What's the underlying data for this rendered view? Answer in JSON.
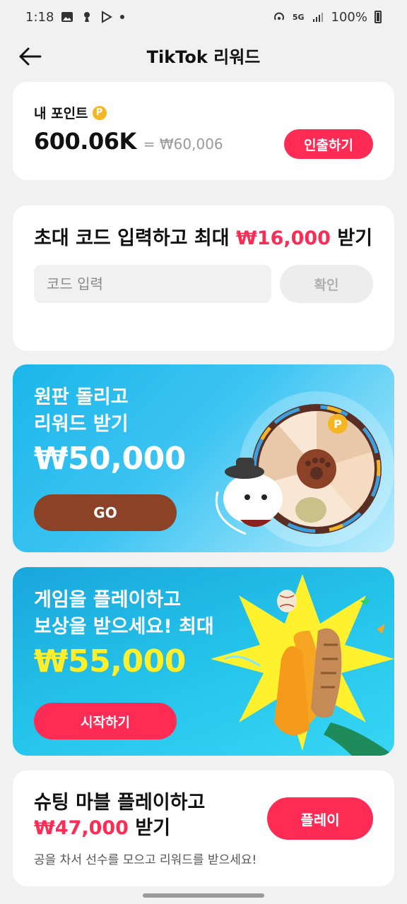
{
  "status_bar": {
    "time": "1:18",
    "battery": "100%",
    "network": "5G"
  },
  "header": {
    "title": "TikTok 리워드"
  },
  "points": {
    "label": "내 포인트",
    "coin_symbol": "P",
    "value": "600.06K",
    "krw_equivalent": "= ₩60,006",
    "withdraw_label": "인출하기"
  },
  "invite": {
    "title_prefix": "초대 코드 입력하고 최대 ",
    "title_amount": "₩16,000",
    "title_suffix": " 받기",
    "input_placeholder": "코드 입력",
    "confirm_label": "확인"
  },
  "wheel_banner": {
    "line1": "원판 돌리고",
    "line2": "리워드 받기",
    "amount": "₩50,000",
    "button_label": "GO"
  },
  "game_banner": {
    "line1": "게임을 플레이하고",
    "line2": "보상을 받으세요! 최대",
    "amount": "₩55,000",
    "button_label": "시작하기"
  },
  "marble": {
    "title_line1": "슈팅 마블 플레이하고",
    "title_amount": "₩47,000",
    "title_suffix": " 받기",
    "subtitle": "공을 차서 선수를 모으고 리워드를 받으세요!",
    "button_label": "플레이"
  },
  "colors": {
    "accent": "#fe2c55",
    "go_button": "#8b4227",
    "amount_yellow": "#ffef2b"
  }
}
